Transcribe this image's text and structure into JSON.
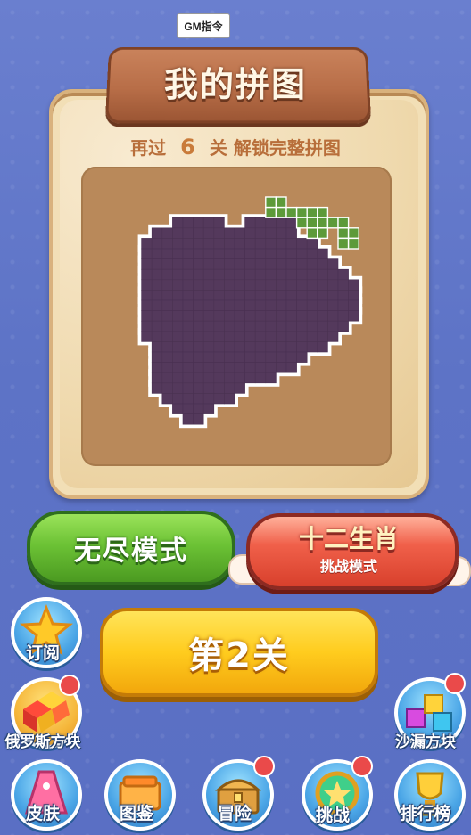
{
  "gm_button": "GM指令",
  "header": {
    "title": "我的拼图"
  },
  "unlock": {
    "prefix": "再过",
    "count": "6",
    "unit": "关",
    "suffix": "解锁完整拼图"
  },
  "modes": {
    "endless": "无尽模式",
    "zodiac_title": "十二生肖",
    "zodiac_sub": "挑战模式"
  },
  "level_button": "第2关",
  "side_buttons": {
    "subscribe": "订阅",
    "tetris": "俄罗斯方块",
    "hourglass": "沙漏方块"
  },
  "bottom_nav": [
    "皮肤",
    "图鉴",
    "冒险",
    "挑战",
    "排行榜"
  ],
  "colors": {
    "grape": "#54395c",
    "leaf": "#5d9a3a",
    "accent_yellow": "#ffcc1e",
    "accent_green": "#6cc235",
    "accent_red": "#e4503c"
  },
  "icons": {
    "subscribe": "star-icon",
    "tetris": "cube-blocks-icon",
    "hourglass": "hourglass-blocks-icon",
    "skin": "dress-icon",
    "collection": "book-icon",
    "adventure": "treasure-chest-icon",
    "challenge": "badge-star-icon",
    "ranking": "trophy-icon"
  }
}
